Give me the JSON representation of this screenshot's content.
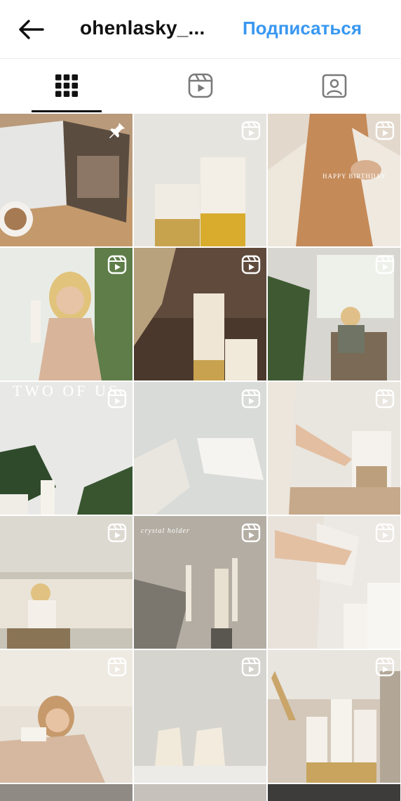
{
  "header": {
    "username": "ohenlasky_...",
    "follow_label": "Подписаться",
    "back_icon": "arrow-left-icon"
  },
  "tabs": [
    {
      "name": "posts",
      "icon": "grid-icon",
      "active": true
    },
    {
      "name": "reels",
      "icon": "reels-icon",
      "active": false
    },
    {
      "name": "tagged",
      "icon": "tagged-person-icon",
      "active": false
    }
  ],
  "posts": [
    {
      "type": "pinned",
      "badge": "pin-icon",
      "subject": "magazine and coffee"
    },
    {
      "type": "reel",
      "badge": "reels-icon",
      "subject": "two candles with gold base"
    },
    {
      "type": "reel",
      "badge": "reels-icon",
      "subject": "woman in orange top",
      "overlay": "HAPPY BIRTHDAY"
    },
    {
      "type": "reel",
      "badge": "reels-icon",
      "subject": "woman holding candle"
    },
    {
      "type": "reel",
      "badge": "reels-icon",
      "subject": "candles with dried grass"
    },
    {
      "type": "reel",
      "badge": "reels-icon",
      "subject": "woman in chair by window"
    },
    {
      "type": "reel",
      "badge": "reels-icon",
      "subject": "plants and candles",
      "overlay": "TWO OF US"
    },
    {
      "type": "reel",
      "badge": "reels-icon",
      "subject": "breaking candle mold"
    },
    {
      "type": "reel",
      "badge": "reels-icon",
      "subject": "hands placing candles"
    },
    {
      "type": "reel",
      "badge": "reels-icon",
      "subject": "woman on sofa"
    },
    {
      "type": "reel",
      "badge": "reels-icon",
      "subject": "taper candles",
      "overlay": "crystal holder"
    },
    {
      "type": "reel",
      "badge": "reels-icon",
      "subject": "pregnant belly and candles"
    },
    {
      "type": "reel",
      "badge": "reels-icon",
      "subject": "woman with candle"
    },
    {
      "type": "reel",
      "badge": "reels-icon",
      "subject": "body shaped candles"
    },
    {
      "type": "reel",
      "badge": "reels-icon",
      "subject": "pillar candles with flowers"
    }
  ],
  "colors": {
    "accent": "#3897f0",
    "text": "#111111",
    "badge": "#ffffff"
  }
}
